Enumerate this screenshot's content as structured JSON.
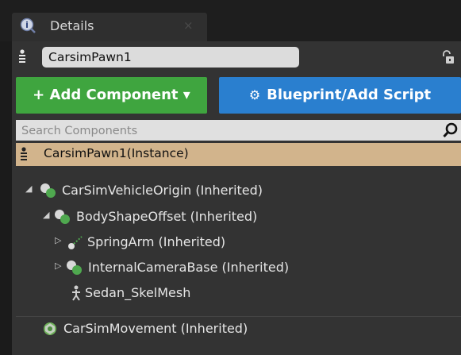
{
  "tab": {
    "label": "Details",
    "close": "×"
  },
  "actor": {
    "name": "CarsimPawn1"
  },
  "toolbar": {
    "add_component_label": "+ Add Component ▾",
    "blueprint_label": "Blueprint/Add Script"
  },
  "search": {
    "placeholder": "Search Components",
    "value": ""
  },
  "instance": {
    "label": "CarsimPawn1(Instance)"
  },
  "tree": {
    "items": [
      {
        "label": "CarSimVehicleOrigin (Inherited)",
        "icon": "scene-component-icon",
        "arrow": "◢"
      },
      {
        "label": "BodyShapeOffset (Inherited)",
        "icon": "scene-component-icon",
        "arrow": "◢"
      },
      {
        "label": "SpringArm (Inherited)",
        "icon": "spring-arm-icon",
        "arrow": "▷"
      },
      {
        "label": "InternalCameraBase (Inherited)",
        "icon": "scene-component-icon",
        "arrow": "▷"
      },
      {
        "label": "Sedan_SkelMesh",
        "icon": "skeletal-mesh-icon",
        "arrow": ""
      }
    ],
    "movement": {
      "label": "CarSimMovement (Inherited)",
      "icon": "movement-component-icon"
    }
  },
  "colors": {
    "add_button": "#3fa53f",
    "blueprint_button": "#2a7fcf",
    "selected_row": "#d2b48c",
    "panel": "#333333"
  }
}
